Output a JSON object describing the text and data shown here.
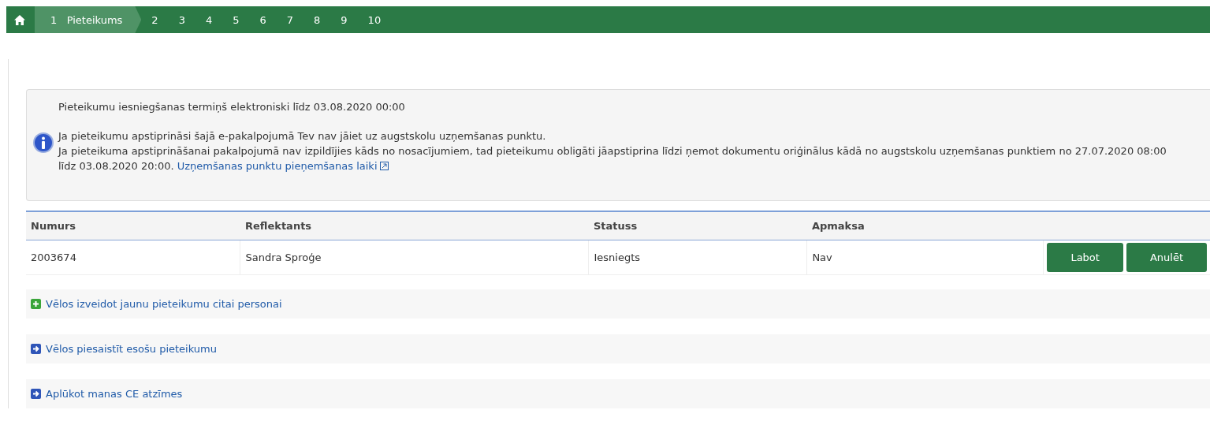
{
  "steps": [
    {
      "number": "1",
      "label": "Pieteikums",
      "selected": true
    },
    {
      "number": "2",
      "selected": false
    },
    {
      "number": "3",
      "selected": false
    },
    {
      "number": "4",
      "selected": false
    },
    {
      "number": "5",
      "selected": false
    },
    {
      "number": "6",
      "selected": false
    },
    {
      "number": "7",
      "selected": false
    },
    {
      "number": "8",
      "selected": false
    },
    {
      "number": "9",
      "selected": false
    },
    {
      "number": "10",
      "selected": false
    }
  ],
  "info": {
    "deadline": "Pieteikumu iesniegšanas termiņš elektroniski līdz 03.08.2020 00:00",
    "lines": [
      "Ja pieteikumu apstiprināsi šajā e-pakalpojumā Tev nav jāiet uz augstskolu uzņemšanas punktu.",
      "Ja pieteikuma apstiprināšanai pakalpojumā nav izpildījies kāds no nosacījumiem, tad pieteikumu obligāti jāapstiprina līdzi ņemot dokumentu oriģinālus kādā no augstskolu uzņemšanas punktiem no 27.07.2020 08:00 līdz 03.08.2020 20:00."
    ],
    "link": "Uzņemšanas punktu pieņemšanas laiki"
  },
  "table": {
    "columns": [
      "Numurs",
      "Reflektants",
      "Statuss",
      "Apmaksa"
    ],
    "rows": [
      {
        "cells": [
          "2003674",
          "Sandra Sproģe",
          "Iesniegts",
          "Nav"
        ],
        "buttons": [
          "Labot",
          "Anulēt"
        ]
      }
    ]
  },
  "actions": [
    {
      "kind": "add",
      "label": "Vēlos izveidot jaunu pieteikumu citai personai"
    },
    {
      "kind": "go",
      "label": "Vēlos piesaistīt esošu pieteikumu"
    },
    {
      "kind": "go",
      "label": "Aplūkot manas CE atzīmes"
    }
  ]
}
